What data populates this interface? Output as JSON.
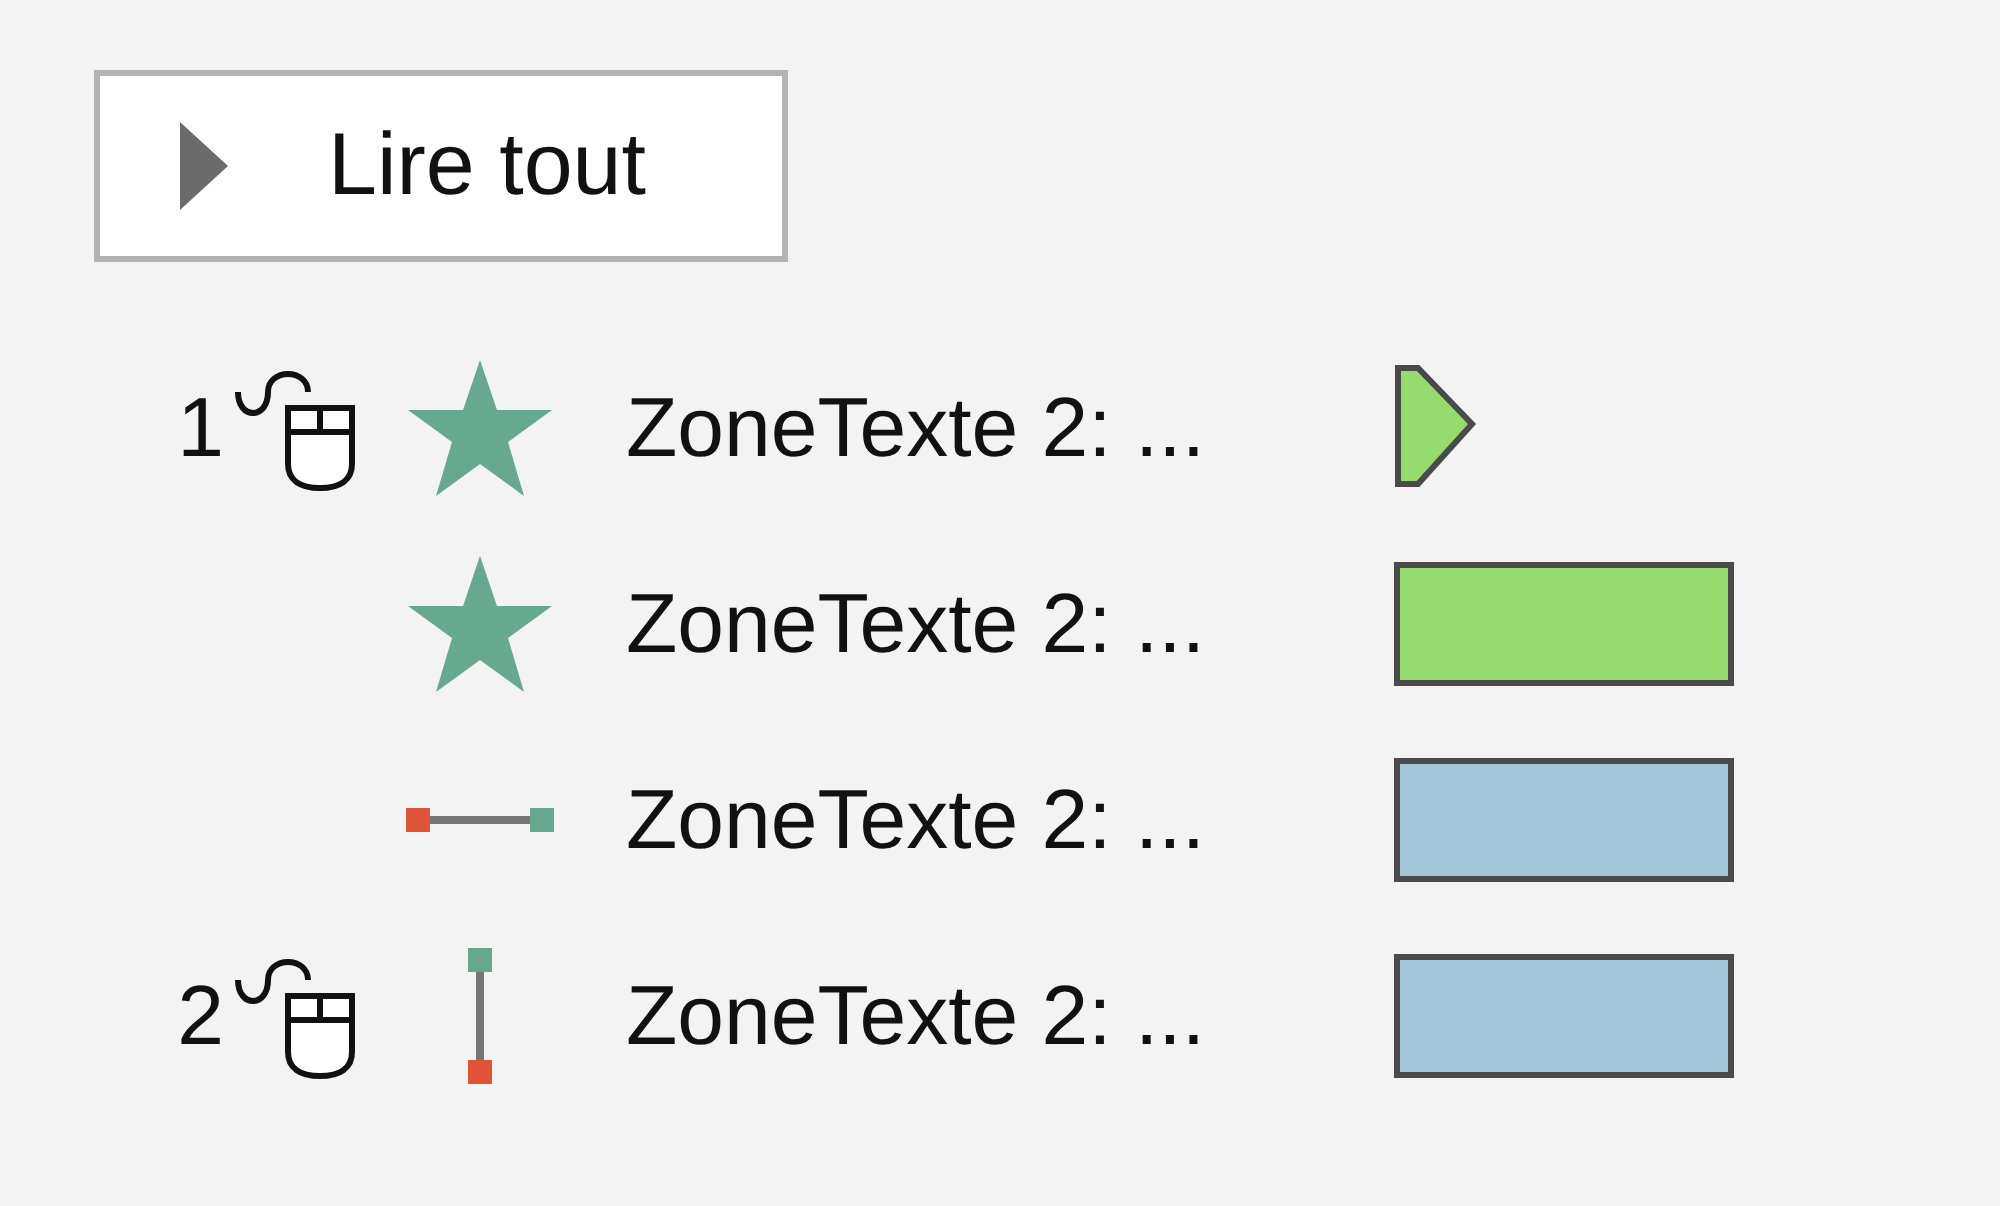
{
  "play_button": {
    "label": "Lire tout"
  },
  "animations": [
    {
      "number": "1",
      "trigger": {
        "kind": "mouse"
      },
      "effect": {
        "kind": "star"
      },
      "label": "ZoneTexte 2: ...",
      "timing": {
        "kind": "marker",
        "color": "#96db6e"
      }
    },
    {
      "effect": {
        "kind": "star"
      },
      "label": "ZoneTexte 2: ...",
      "timing": {
        "kind": "bar",
        "color": "#96db6e"
      }
    },
    {
      "effect": {
        "kind": "horizontal"
      },
      "label": "ZoneTexte 2: ...",
      "timing": {
        "kind": "bar",
        "color": "#a3c6da"
      }
    },
    {
      "number": "2",
      "trigger": {
        "kind": "mouse"
      },
      "effect": {
        "kind": "vertical"
      },
      "label": "ZoneTexte 2: ...",
      "timing": {
        "kind": "bar",
        "color": "#a3c6da"
      }
    }
  ]
}
